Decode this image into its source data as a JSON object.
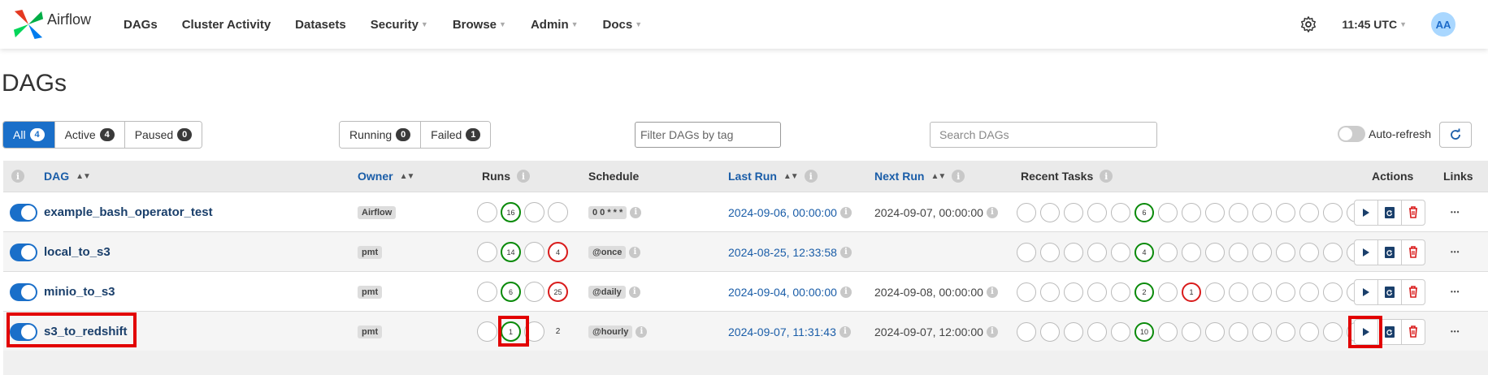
{
  "brand": {
    "name": "Airflow"
  },
  "nav": [
    {
      "label": "DAGs",
      "caret": false
    },
    {
      "label": "Cluster Activity",
      "caret": false
    },
    {
      "label": "Datasets",
      "caret": false
    },
    {
      "label": "Security",
      "caret": true
    },
    {
      "label": "Browse",
      "caret": true
    },
    {
      "label": "Admin",
      "caret": true
    },
    {
      "label": "Docs",
      "caret": true
    }
  ],
  "header": {
    "time": "11:45 UTC",
    "avatar": "AA"
  },
  "page_title": "DAGs",
  "filters": {
    "status": [
      {
        "label": "All",
        "count": "4",
        "active": true
      },
      {
        "label": "Active",
        "count": "4",
        "active": false
      },
      {
        "label": "Paused",
        "count": "0",
        "active": false
      }
    ],
    "state": [
      {
        "label": "Running",
        "count": "0"
      },
      {
        "label": "Failed",
        "count": "1"
      }
    ],
    "tag_filter_placeholder": "Filter DAGs by tag",
    "search_placeholder": "Search DAGs",
    "auto_refresh_label": "Auto-refresh"
  },
  "columns": {
    "dag": "DAG",
    "owner": "Owner",
    "runs": "Runs",
    "schedule": "Schedule",
    "last_run": "Last Run",
    "next_run": "Next Run",
    "recent_tasks": "Recent Tasks",
    "actions": "Actions",
    "links": "Links"
  },
  "rows": [
    {
      "name": "example_bash_operator_test",
      "owner": "Airflow",
      "schedule": "0 0 * * *",
      "last_run": "2024-09-06, 00:00:00",
      "next_run": "2024-09-07, 00:00:00",
      "runs": [
        {
          "v": "",
          "c": ""
        },
        {
          "v": "16",
          "c": "g"
        },
        {
          "v": "",
          "c": ""
        },
        {
          "v": "",
          "c": ""
        }
      ],
      "tasks": [
        "",
        "",
        "",
        "",
        "",
        "6",
        "",
        "",
        "",
        "",
        "",
        "",
        "",
        "",
        ""
      ],
      "task_colors": {
        "5": "g"
      }
    },
    {
      "name": "local_to_s3",
      "owner": "pmt",
      "schedule": "@once",
      "last_run": "2024-08-25, 12:33:58",
      "next_run": "",
      "runs": [
        {
          "v": "",
          "c": ""
        },
        {
          "v": "14",
          "c": "g"
        },
        {
          "v": "",
          "c": ""
        },
        {
          "v": "4",
          "c": "r"
        }
      ],
      "tasks": [
        "",
        "",
        "",
        "",
        "",
        "4",
        "",
        "",
        "",
        "",
        "",
        "",
        "",
        "",
        ""
      ],
      "task_colors": {
        "5": "g"
      }
    },
    {
      "name": "minio_to_s3",
      "owner": "pmt",
      "schedule": "@daily",
      "last_run": "2024-09-04, 00:00:00",
      "next_run": "2024-09-08, 00:00:00",
      "runs": [
        {
          "v": "",
          "c": ""
        },
        {
          "v": "6",
          "c": "g"
        },
        {
          "v": "",
          "c": ""
        },
        {
          "v": "25",
          "c": "r"
        }
      ],
      "tasks": [
        "",
        "",
        "",
        "",
        "",
        "2",
        "",
        "1",
        "",
        "",
        "",
        "",
        "",
        "",
        ""
      ],
      "task_colors": {
        "5": "g",
        "7": "r"
      }
    },
    {
      "name": "s3_to_redshift",
      "owner": "pmt",
      "schedule": "@hourly",
      "last_run": "2024-09-07, 11:31:43",
      "next_run": "2024-09-07, 12:00:00",
      "runs": [
        {
          "v": "",
          "c": ""
        },
        {
          "v": "1",
          "c": "g"
        },
        {
          "v": "",
          "c": ""
        },
        {
          "v": "2",
          "c": "plain"
        }
      ],
      "tasks": [
        "",
        "",
        "",
        "",
        "",
        "10",
        "",
        "",
        "",
        "",
        "",
        "",
        "",
        "",
        ""
      ],
      "task_colors": {
        "5": "g"
      }
    }
  ],
  "colors": {
    "accent": "#1a6fc9",
    "success": "#0a8a0a",
    "failed": "#d91b1b",
    "highlight": "#e20000"
  }
}
